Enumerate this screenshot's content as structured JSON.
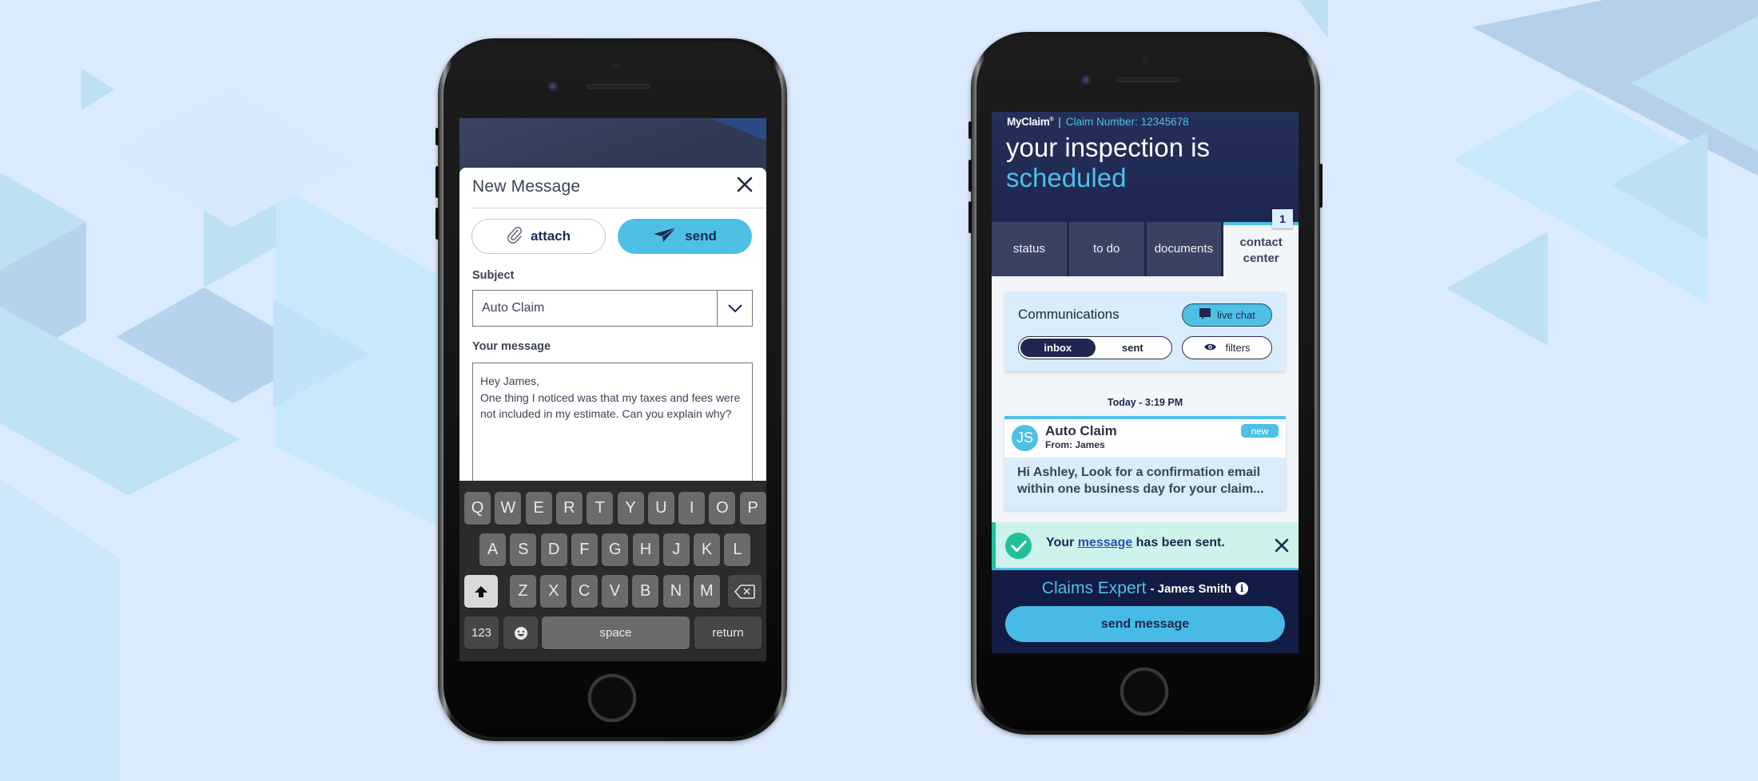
{
  "colors": {
    "accent": "#4ec0e6",
    "navy": "#1d2750",
    "success": "#22c09a",
    "background": "#dbeafd"
  },
  "left_phone": {
    "modal": {
      "title": "New Message",
      "close_icon": "close-icon",
      "attach_label": "attach",
      "attach_icon": "paperclip-icon",
      "send_label": "send",
      "send_icon": "paper-plane-icon",
      "subject_label": "Subject",
      "subject_value": "Auto Claim",
      "subject_caret_icon": "chevron-down-icon",
      "message_label": "Your message",
      "message_value": "Hey James,\nOne thing I noticed was that my taxes and fees were not included in my estimate. Can you explain why?"
    },
    "keyboard": {
      "row1": [
        "Q",
        "W",
        "E",
        "R",
        "T",
        "Y",
        "U",
        "I",
        "O",
        "P"
      ],
      "row2": [
        "A",
        "S",
        "D",
        "F",
        "G",
        "H",
        "J",
        "K",
        "L"
      ],
      "row3": [
        "Z",
        "X",
        "C",
        "V",
        "B",
        "N",
        "M"
      ],
      "shift_icon": "shift-arrow-icon",
      "delete_icon": "backspace-icon",
      "numbers_label": "123",
      "emoji_icon": "emoji-icon",
      "space_label": "space",
      "return_label": "return"
    }
  },
  "right_phone": {
    "header": {
      "brand": "MyClaim",
      "brand_mark": "®",
      "separator": "|",
      "claim_number": "Claim Number: 12345678",
      "headline_line1": "your inspection is",
      "headline_line2": "scheduled"
    },
    "tabs": [
      {
        "label": "status",
        "active": false
      },
      {
        "label": "to do",
        "active": false
      },
      {
        "label": "documents",
        "active": false
      },
      {
        "label": "contact\ncenter",
        "active": true
      }
    ],
    "tab_badge": "1",
    "communications": {
      "title": "Communications",
      "live_chat_label": "live chat",
      "live_chat_icon": "chat-bubble-icon",
      "inbox_label": "inbox",
      "sent_label": "sent",
      "selected": "inbox",
      "filters_label": "filters",
      "filters_icon": "eye-icon"
    },
    "date_label": "Today - 3:19 PM",
    "message": {
      "avatar_initials": "JS",
      "subject": "Auto Claim",
      "from": "From: James",
      "badge": "new",
      "preview": "Hi Ashley, Look for a confirmation email within one business day for your claim..."
    },
    "toast": {
      "icon": "check-circle-icon",
      "text_before": "Your ",
      "link_text": "message",
      "text_after": " has been sent.",
      "close_icon": "close-icon"
    },
    "footer": {
      "expert_title": "Claims Expert",
      "expert_name": "- James Smith",
      "info_icon": "info-icon",
      "send_message_label": "send message"
    }
  }
}
